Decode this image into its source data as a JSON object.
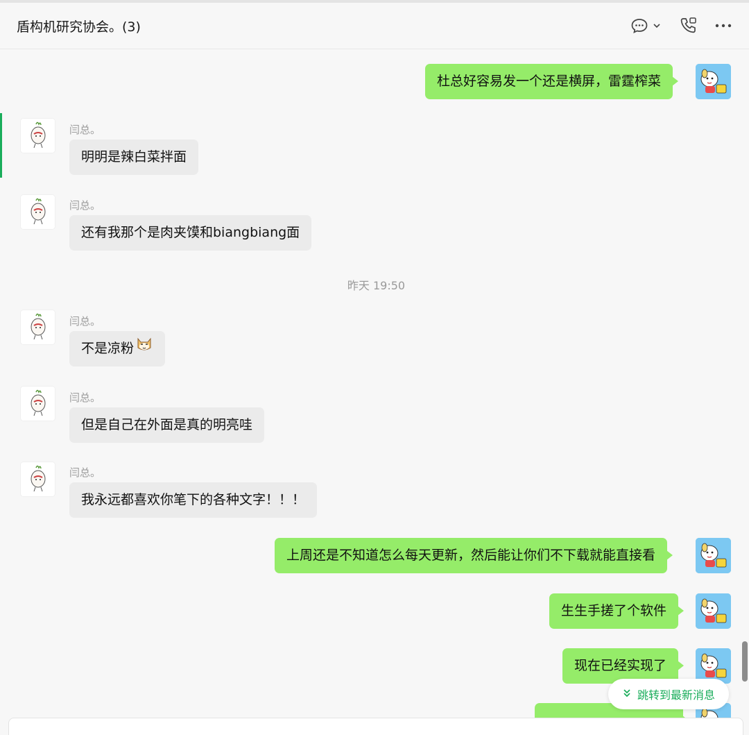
{
  "header": {
    "title": "盾构机研究协会。(3)",
    "icons": [
      "chat-bubble-icon",
      "chevron-down-icon",
      "phone-icon",
      "more-icon"
    ]
  },
  "colors": {
    "outgoing_bubble": "#95ec69",
    "incoming_bubble": "#ebebeb",
    "accent": "#1aad5b",
    "background": "#f7f7f7"
  },
  "messages": [
    {
      "direction": "out",
      "text": "杜总好容易发一个还是横屏，雷霆榨菜"
    },
    {
      "direction": "in",
      "sender": "闫总。",
      "text": "明明是辣白菜拌面"
    },
    {
      "direction": "in",
      "sender": "闫总。",
      "text": "还有我那个是肉夹馍和biangbiang面"
    },
    {
      "direction": "in",
      "sender": "闫总。",
      "text": "不是凉粉",
      "emoji": "cat-face-icon"
    },
    {
      "direction": "in",
      "sender": "闫总。",
      "text": "但是自己在外面是真的明亮哇"
    },
    {
      "direction": "in",
      "sender": "闫总。",
      "text": "我永远都喜欢你笔下的各种文字！！！"
    },
    {
      "direction": "out",
      "text": "上周还是不知道怎么每天更新，然后能让你们不下载就能直接看"
    },
    {
      "direction": "out",
      "text": "生生手搓了个软件"
    },
    {
      "direction": "out",
      "text": "现在已经实现了"
    }
  ],
  "timestamp": "昨天 19:50",
  "jump_button": {
    "label": "跳转到最新消息",
    "icon": "double-chevron-down-icon"
  }
}
